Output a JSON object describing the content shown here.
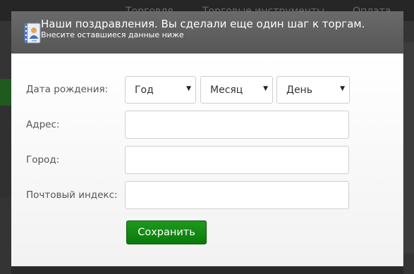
{
  "background": {
    "nav_items": [
      "Торговля",
      "Торговые инструменты",
      "Оплата"
    ]
  },
  "modal": {
    "icon": "contacts-book-icon",
    "title": "Наши поздравления. Вы сделали еще один шаг к торгам.",
    "subtitle": "Внесите оставшиеся данные ниже"
  },
  "form": {
    "birth_date": {
      "label": "Дата рождения:",
      "year": "Год",
      "month": "Месяц",
      "day": "День"
    },
    "address": {
      "label": "Адрес:",
      "value": ""
    },
    "city": {
      "label": "Город:",
      "value": ""
    },
    "postal_code": {
      "label": "Почтовый индекс:",
      "value": ""
    },
    "save_label": "Сохранить"
  },
  "colors": {
    "header_bg": "#5e5e5e",
    "save_button": "#168b16",
    "page_bg": "#2f2f2f"
  }
}
